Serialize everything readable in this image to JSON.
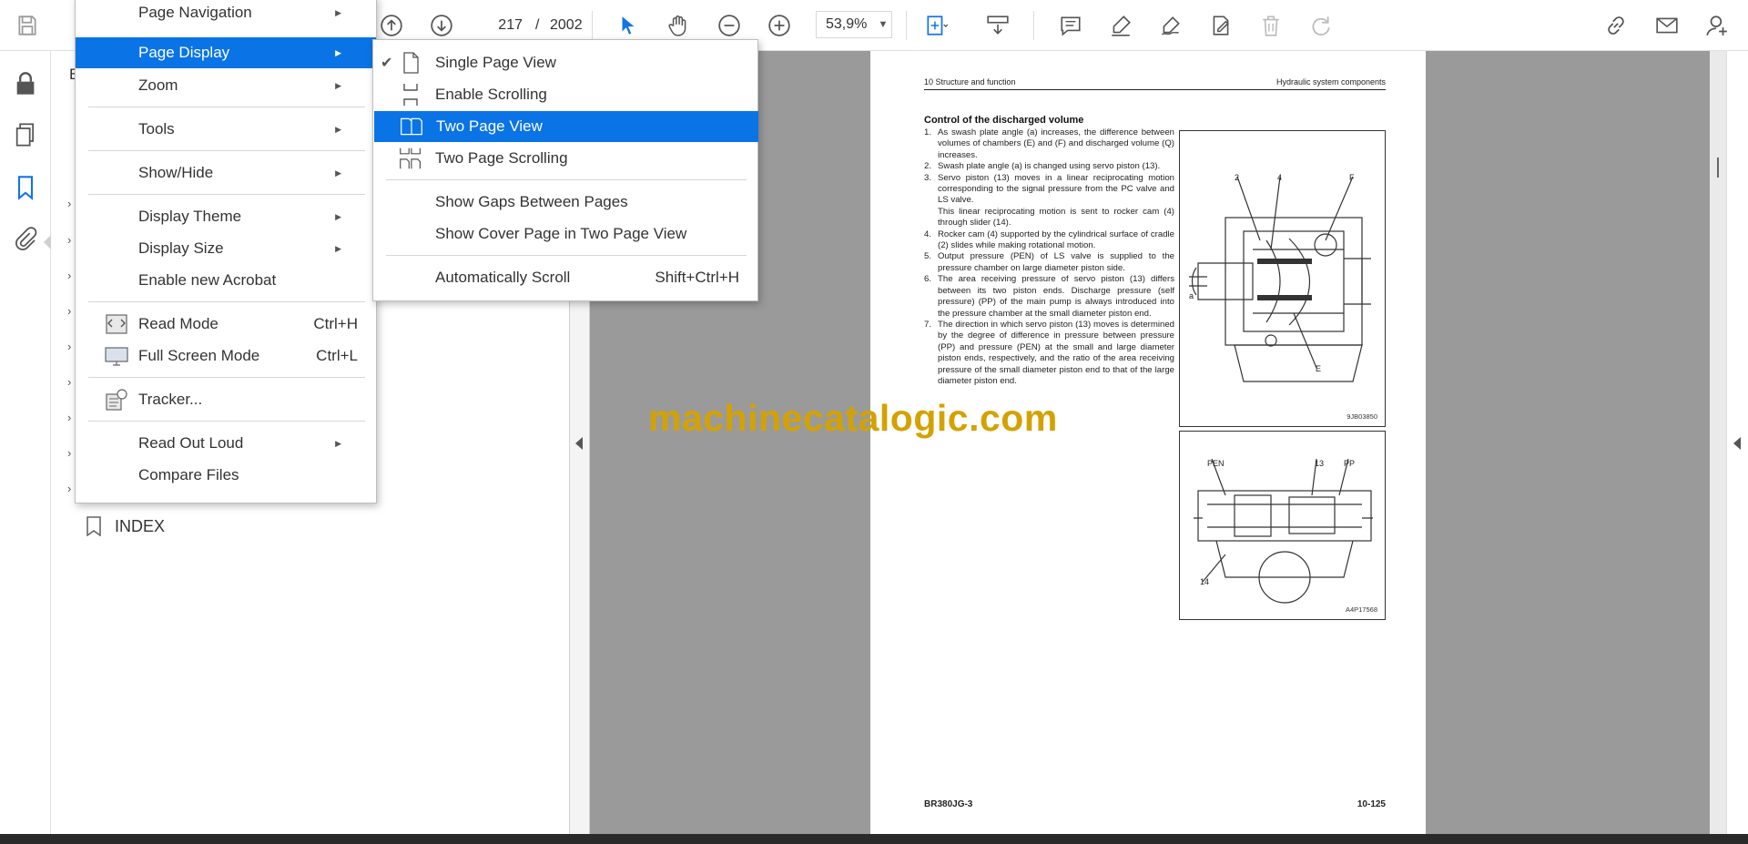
{
  "toolbar": {
    "current_page": "217",
    "page_separator": "/",
    "total_pages": "2002",
    "zoom": "53,9%"
  },
  "bookmarks": {
    "partial_label": "B",
    "items": [
      {
        "label": "INDEX"
      }
    ]
  },
  "view_menu": {
    "items": [
      {
        "label": "Page Navigation",
        "has_submenu": true
      },
      {
        "label": "Page Display",
        "has_submenu": true,
        "highlighted": true
      },
      {
        "label": "Zoom",
        "has_submenu": true
      },
      {
        "label": "Tools",
        "has_submenu": true
      },
      {
        "label": "Show/Hide",
        "has_submenu": true
      },
      {
        "label": "Display Theme",
        "has_submenu": true
      },
      {
        "label": "Display Size",
        "has_submenu": true
      },
      {
        "label": "Enable new Acrobat"
      },
      {
        "label": "Read Mode",
        "shortcut": "Ctrl+H",
        "icon": "read-mode-icon"
      },
      {
        "label": "Full Screen Mode",
        "shortcut": "Ctrl+L",
        "icon": "full-screen-icon"
      },
      {
        "label": "Tracker...",
        "icon": "tracker-icon"
      },
      {
        "label": "Read Out Loud",
        "has_submenu": true
      },
      {
        "label": "Compare Files"
      }
    ]
  },
  "page_display_menu": {
    "items": [
      {
        "label": "Single Page View",
        "checked": true,
        "icon": "single-page-icon"
      },
      {
        "label": "Enable Scrolling",
        "icon": "scrolling-icon"
      },
      {
        "label": "Two Page View",
        "highlighted": true,
        "icon": "two-page-icon"
      },
      {
        "label": "Two Page Scrolling",
        "icon": "two-page-scrolling-icon"
      },
      {
        "label": "Show Gaps Between Pages"
      },
      {
        "label": "Show Cover Page in Two Page View"
      },
      {
        "label": "Automatically Scroll",
        "shortcut": "Shift+Ctrl+H"
      }
    ]
  },
  "document": {
    "header_left": "10 Structure and function",
    "header_right": "Hydraulic system components",
    "section_title": "Control of the discharged volume",
    "items": [
      {
        "num": "1.",
        "text": "As swash plate angle (a) increases, the difference between volumes of chambers (E) and (F) and discharged volume (Q) increases."
      },
      {
        "num": "2.",
        "text": "Swash plate angle (a) is changed using servo piston (13)."
      },
      {
        "num": "3.",
        "text": "Servo piston (13) moves in a linear reciprocating motion corresponding to the signal pressure from the PC valve and LS valve."
      },
      {
        "num": "",
        "text": "This linear reciprocating motion is sent to rocker cam (4) through slider (14)."
      },
      {
        "num": "4.",
        "text": "Rocker cam (4) supported by the cylindrical surface of cradle (2) slides while making rotational motion."
      },
      {
        "num": "5.",
        "text": "Output pressure (PEN) of LS valve is supplied to the pressure chamber on large diameter piston side."
      },
      {
        "num": "6.",
        "text": "The area receiving pressure of servo piston (13) differs between its two piston ends. Discharge pressure (self pressure) (PP) of the main pump is always introduced into the pressure chamber at the small diameter piston end."
      },
      {
        "num": "7.",
        "text": "The direction in which servo piston (13) moves is determined by the degree of difference in pressure between pressure (PP) and pressure (PEN) at the small and large diameter piston ends, respectively, and the ratio of the area receiving pressure of the small diameter piston end to that of the large diameter piston end."
      }
    ],
    "figure1": {
      "code": "9JB03850",
      "labels": {
        "l2": "2",
        "l4": "4",
        "lF": "F",
        "la": "a",
        "lE": "E"
      }
    },
    "figure2": {
      "code": "A4P17568",
      "labels": {
        "pen": "PEN",
        "l13": "13",
        "pp": "PP",
        "l14": "14"
      }
    },
    "footer_left": "BR380JG-3",
    "footer_right": "10-125"
  },
  "watermark": "machinecatalogic.com",
  "colors": {
    "accent": "#0a74e6",
    "watermark": "#d4a200",
    "doc_bg": "#9a9a9a"
  }
}
